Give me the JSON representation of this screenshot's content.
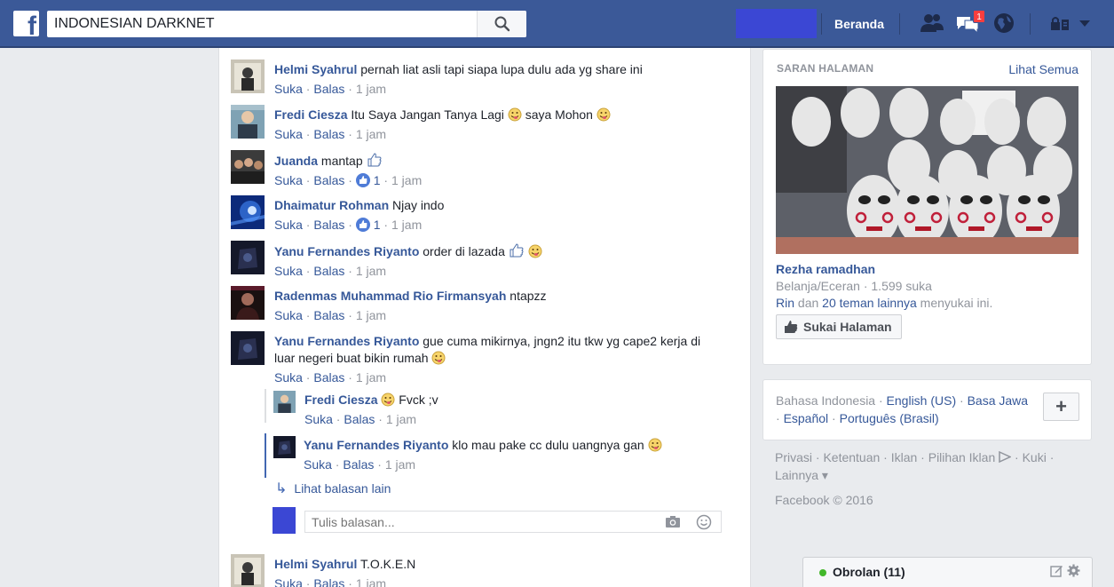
{
  "topbar": {
    "logo": "f",
    "search_value": "INDONESIAN DARKNET",
    "home_label": "Beranda",
    "notification_count": "1"
  },
  "comments": [
    {
      "author": "Helmi Syahrul",
      "text": "pernah liat asli tapi siapa lupa dulu ada yg share ini",
      "like": "Suka",
      "reply": "Balas",
      "time": "1 jam"
    },
    {
      "author": "Fredi Ciesza",
      "text": "Itu Saya Jangan Tanya Lagi",
      "text2": "saya Mohon",
      "like": "Suka",
      "reply": "Balas",
      "time": "1 jam"
    },
    {
      "author": "Juanda",
      "text": "mantap",
      "like": "Suka",
      "reply": "Balas",
      "likes": "1",
      "time": "1 jam"
    },
    {
      "author": "Dhaimatur Rohman",
      "text": "Njay indo",
      "like": "Suka",
      "reply": "Balas",
      "likes": "1",
      "time": "1 jam"
    },
    {
      "author": "Yanu Fernandes Riyanto",
      "text": "order di lazada",
      "like": "Suka",
      "reply": "Balas",
      "time": "1 jam"
    },
    {
      "author": "Radenmas Muhammad Rio Firmansyah",
      "text": "ntapzz",
      "like": "Suka",
      "reply": "Balas",
      "time": "1 jam"
    },
    {
      "author": "Yanu Fernandes Riyanto",
      "text": "gue cuma mikirnya, jngn2 itu tkw yg cape2 kerja di",
      "text2": "luar negeri buat bikin rumah",
      "like": "Suka",
      "reply": "Balas",
      "time": "1 jam"
    },
    {
      "author": "Helmi Syahrul",
      "text": "T.O.K.E.N",
      "like": "Suka",
      "reply": "Balas",
      "time": "1 jam"
    }
  ],
  "replies": [
    {
      "author": "Fredi Ciesza",
      "text": "Fvck ;v",
      "like": "Suka",
      "reply": "Balas",
      "time": "1 jam"
    },
    {
      "author": "Yanu Fernandes Riyanto",
      "text": "klo mau pake cc dulu uangnya gan",
      "like": "Suka",
      "reply": "Balas",
      "time": "1 jam"
    }
  ],
  "more_replies_label": "Lihat balasan lain",
  "reply_placeholder": "Tulis balasan...",
  "suggested": {
    "title": "SARAN HALAMAN",
    "see_all": "Lihat Semua",
    "page_name": "Rezha ramadhan",
    "category": "Belanja/Eceran · 1.599 suka",
    "friend1": "Rin",
    "friends_mid": " dan ",
    "friends_link": "20 teman lainnya",
    "friends_tail": " menyukai ini.",
    "like_button": "Sukai Halaman"
  },
  "languages": {
    "current": "Bahasa Indonesia",
    "sep": " · ",
    "items": [
      "English (US)",
      "Basa Jawa",
      "Español",
      "Português (Brasil)"
    ],
    "add": "+"
  },
  "footer": {
    "links_line1": "Privasi · Ketentuan · Iklan · Pilihan Iklan",
    "kuki": " · Kuki ·",
    "links_line2": "Lainnya ▾",
    "copyright": "Facebook © 2016"
  },
  "chat": {
    "label": "Obrolan (11)"
  },
  "colors": {
    "brand": "#3b5998",
    "link": "#365899",
    "muted": "#90949c",
    "online": "#42b72a",
    "badge": "#fa3e3e"
  }
}
